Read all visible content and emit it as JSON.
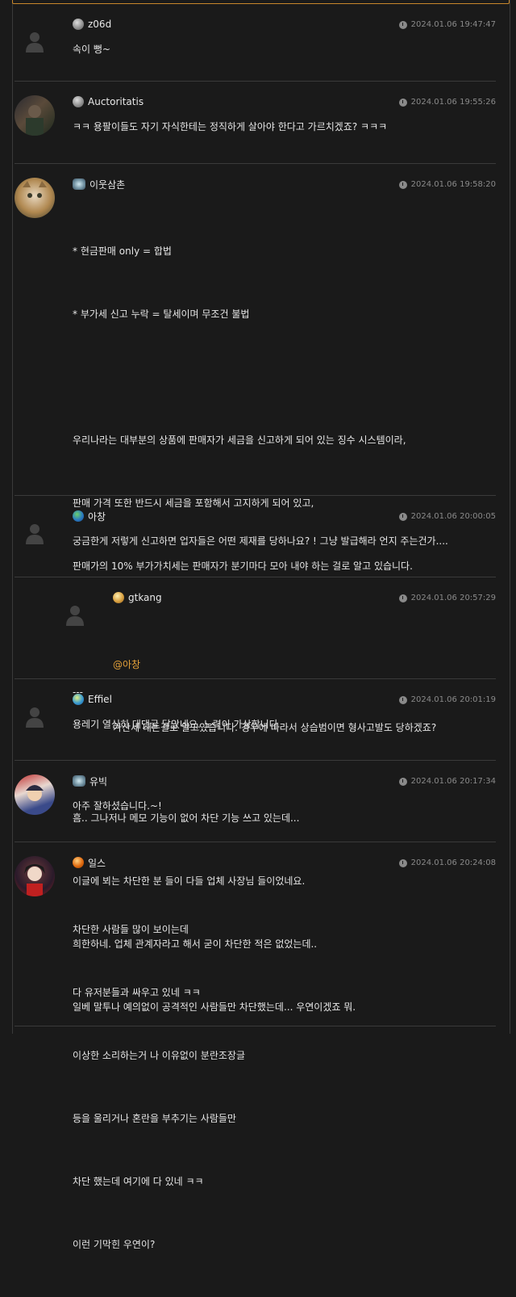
{
  "comments": [
    {
      "nick": "z06d",
      "date": "2024.01.06 19:47:47",
      "lines": [
        "속이 뻥~"
      ]
    },
    {
      "nick": "Auctoritatis",
      "date": "2024.01.06 19:55:26",
      "lines": [
        "ㅋㅋ 용팔이들도 자기 자식한테는 정직하게 살아야 한다고 가르치겠죠? ㅋㅋㅋ"
      ]
    },
    {
      "nick": "이웃삼촌",
      "date": "2024.01.06 19:58:20",
      "lines": [
        "* 현금판매 only = 합법",
        "* 부가세 신고 누락 = 탈세이며 무조건 불법",
        "",
        "우리나라는 대부분의 상품에 판매자가 세금을 신고하게 되어 있는 징수 시스템이라,",
        "판매 가격 또한 반드시 세금을 포함해서 고지하게 되어 있고,",
        "판매가의 10% 부가가치세는 판매자가 분기마다 모아 내야 하는 걸로 알고 있습니다.",
        "",
        "---",
        "",
        "흠.. 그나저나 메모 기능이 없어 차단 기능 쓰고 있는데...",
        "이글에 뵈는 차단한 분 들이 다들 업체 사장님 들이었네요.",
        "희한하네. 업체 관계자라고 해서 굳이 차단한 적은 없었는데..",
        "일베 말투나 예의없이 공격적인 사람들만 차단했는데... 우연이겠죠 뭐."
      ]
    },
    {
      "nick": "아창",
      "date": "2024.01.06 20:00:05",
      "lines": [
        "궁금한게 저렇게 신고하면 업자들은 어떤 제재를 당하나요? ! 그냥 발급해라 언지 주는건가...."
      ]
    },
    {
      "nick": "gtkang",
      "date": "2024.01.06 20:57:29",
      "mention": "@아창",
      "lines": [
        "가산세 내는걸로 알고있습니다. 경우에 따라서 상습범이면 형사고발도 당하겠죠?"
      ]
    },
    {
      "nick": "Effiel",
      "date": "2024.01.06 20:01:19",
      "lines": [
        "용레기 열심히 대댓글 달았네요. 노력이 가상합니다"
      ]
    },
    {
      "nick": "유빅",
      "date": "2024.01.06 20:17:34",
      "lines": [
        "아주 잘하셨습니다.~!"
      ]
    },
    {
      "nick": "일스",
      "date": "2024.01.06 20:24:08",
      "lines": [
        "차단한 사람들 많이 보이는데",
        "다 유저분들과 싸우고 있네 ㅋㅋ",
        "이상한 소리하는거 나 이유없이 분란조장글",
        "등을 울리거나 혼란을 부추기는 사람들만",
        "차단 했는데 여기에 다 있네 ㅋㅋ",
        "이런 기막힌 우연이?"
      ]
    }
  ],
  "colors": {
    "accent": "#e5a23a",
    "bg": "#1a1a1a",
    "border": "#3a3a3a"
  },
  "icons": [
    "default-avatar-icon",
    "level-icon",
    "clock-icon"
  ]
}
